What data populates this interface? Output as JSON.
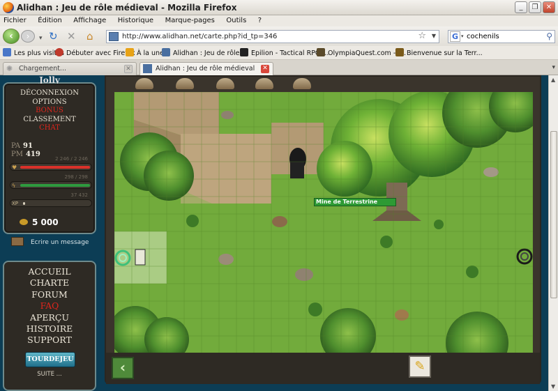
{
  "window": {
    "title": "Alidhan : Jeu de rôle médieval - Mozilla Firefox"
  },
  "menubar": [
    "Fichier",
    "Édition",
    "Affichage",
    "Historique",
    "Marque-pages",
    "Outils",
    "?"
  ],
  "navigation": {
    "url": "http://www.alidhan.net/carte.php?id_tp=346",
    "search_value": "cochenils"
  },
  "bookmarks": [
    {
      "label": "Les plus visités",
      "icon": "bookmark-page-icon",
      "color": "#4a77c8"
    },
    {
      "label": "Débuter avec Firefox",
      "icon": "firefox-icon",
      "color": "#c0392b"
    },
    {
      "label": "À la une",
      "icon": "rss-icon",
      "color": "#e8a317"
    },
    {
      "label": "Alidhan : Jeu de rôle ...",
      "icon": "alidhan-icon",
      "color": "#4a6fa0"
    },
    {
      "label": "Epilion - Tactical RPG ...",
      "icon": "epilion-icon",
      "color": "#222222"
    },
    {
      "label": "OlympiaQuest.com - j...",
      "icon": "olympia-icon",
      "color": "#5a4a2a"
    },
    {
      "label": "Bienvenue sur la Terr...",
      "icon": "terre-icon",
      "color": "#7a5a1a"
    }
  ],
  "tabs": [
    {
      "label": "Chargement...",
      "active": false
    },
    {
      "label": "Alidhan : Jeu de rôle médieval",
      "active": true
    }
  ],
  "game": {
    "player_name": "Jolly",
    "menu": [
      {
        "label": "DÉCONNEXION",
        "highlight": false
      },
      {
        "label": "OPTIONS",
        "highlight": false
      },
      {
        "label": "BONUS",
        "highlight": true
      },
      {
        "label": "CLASSEMENT",
        "highlight": false
      },
      {
        "label": "CHAT",
        "highlight": true
      }
    ],
    "stats": {
      "pa_label": "PA",
      "pa_value": "91",
      "pm_label": "PM",
      "pm_value": "419",
      "hp_text": "2 246 / 2 246",
      "hp_fraction": 1.0,
      "mana_text": "298 / 298",
      "mana_fraction": 1.0,
      "xp_label": "XP",
      "xp_text": "37 432",
      "xp_fraction": 0.02,
      "gold": "5 000"
    },
    "message_link": "Ecrire un message",
    "site_nav": [
      {
        "label": "ACCUEIL",
        "highlight": false
      },
      {
        "label": "CHARTE",
        "highlight": false
      },
      {
        "label": "FORUM",
        "highlight": false
      },
      {
        "label": "FAQ",
        "highlight": true
      },
      {
        "label": "APERÇU",
        "highlight": false
      },
      {
        "label": "HISTOIRE",
        "highlight": false
      },
      {
        "label": "SUPPORT",
        "highlight": false
      }
    ],
    "tourdejeu_label": "TOURDEJEU",
    "suite_label": "SUITE ...",
    "map_location_label": "Mine de Terrestrine"
  },
  "colors": {
    "highlight_red": "#e0251c",
    "hp_bar": "#d9312a",
    "mana_bar": "#2e9a3e",
    "grass": "#6ea83a"
  }
}
